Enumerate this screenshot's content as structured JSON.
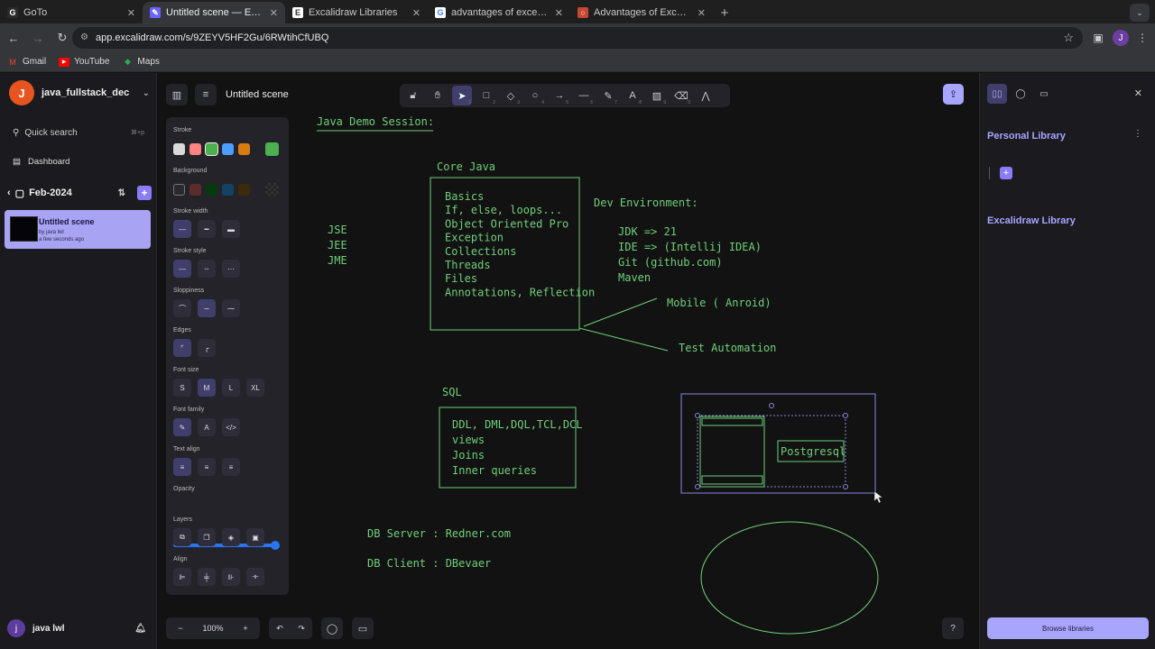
{
  "browser": {
    "tabs": [
      {
        "title": "GoTo",
        "icon": "goto-icon",
        "color": "#2b2b2b",
        "glyph": "G"
      },
      {
        "title": "Untitled scene — Excalidraw Plus",
        "icon": "excalidraw-icon",
        "color": "#6c63ff",
        "glyph": "✎"
      },
      {
        "title": "Excalidraw Libraries",
        "icon": "excalidraw-icon",
        "color": "#ffffff",
        "glyph": "E"
      },
      {
        "title": "advantages of exception handling",
        "icon": "google-icon",
        "color": "#ffffff",
        "glyph": "G"
      },
      {
        "title": "Advantages of Exceptions (The Java™",
        "icon": "oracle-icon",
        "color": "#c74634",
        "glyph": "○"
      }
    ],
    "url": "app.excalidraw.com/s/9ZEYV5HF2Gu/6RWtihCfUBQ",
    "bookmarks": [
      {
        "label": "Gmail",
        "icon": "gmail-icon"
      },
      {
        "label": "YouTube",
        "icon": "youtube-icon"
      },
      {
        "label": "Maps",
        "icon": "maps-icon"
      }
    ],
    "profile_initial": "J"
  },
  "sidebar": {
    "workspace_initial": "J",
    "workspace_name": "java_fullstack_dec",
    "search_placeholder": "Quick search",
    "search_shortcut": "⌘+p",
    "dashboard": "Dashboard",
    "collection": "Feb-2024",
    "scene": {
      "title": "Untitled scene",
      "author": "by java lwl",
      "time": "a few seconds ago"
    },
    "user_initial": "j",
    "user_name": "java lwl"
  },
  "canvas": {
    "title": "Untitled scene",
    "zoom": "100%",
    "props": {
      "stroke": "Stroke",
      "background": "Background",
      "stroke_width": "Stroke width",
      "stroke_style": "Stroke style",
      "sloppiness": "Sloppiness",
      "edges": "Edges",
      "font_size": "Font size",
      "font_sizes": [
        "S",
        "M",
        "L",
        "XL"
      ],
      "font_family": "Font family",
      "text_align": "Text align",
      "opacity": "Opacity",
      "opacity_value": 1.0,
      "layers": "Layers",
      "align": "Align",
      "stroke_colors": [
        "#d9d9d9",
        "#ff8383",
        "#4caf50",
        "#4a9eff",
        "#d97b0f"
      ],
      "current_stroke": "#4caf50",
      "bg_colors": [
        "transparent",
        "#5b2c2c",
        "#043b0c",
        "#154163",
        "#3b2b0a"
      ]
    },
    "drawing": {
      "heading": "Java Demo Session:",
      "core_java_label": "Core Java",
      "core_java_items": [
        "Basics",
        "If, else, loops...",
        "Object Oriented Pro",
        "Exception",
        "Collections",
        "Threads",
        "Files",
        "Annotations, Reflection"
      ],
      "editions": [
        "JSE",
        "JEE",
        "JME"
      ],
      "dev_env_label": "Dev Environment:",
      "dev_env_items": [
        "JDK => 21",
        "IDE => (Intellij IDEA)",
        "Git (github.com)",
        "Maven"
      ],
      "mobile": "Mobile ( Anroid)",
      "test_automation": "Test Automation",
      "sql_label": "SQL",
      "sql_items": [
        "DDL, DML,DQL,TCL,DCL",
        "views",
        "Joins",
        "Inner queries"
      ],
      "postgres": "Postgresql",
      "db_server": "DB Server : Redner.com",
      "db_client": "DB Client : DBevaer",
      "stroke_color": "#6fcf7a"
    }
  },
  "library": {
    "personal": "Personal Library",
    "excalidraw": "Excalidraw Library",
    "browse": "Browse libraries"
  }
}
